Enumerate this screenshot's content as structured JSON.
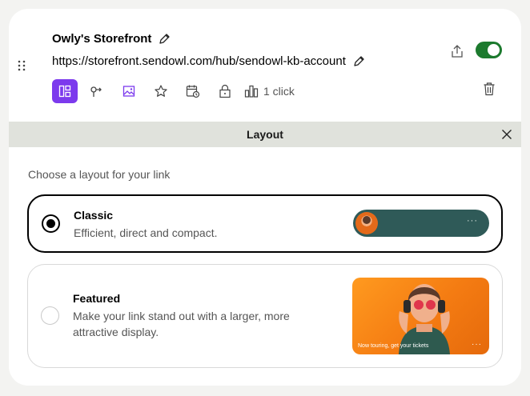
{
  "link": {
    "title": "Owly's Storefront",
    "url": "https://storefront.sendowl.com/hub/sendowl-kb-account",
    "enabled": true,
    "clicks_label": "1 click"
  },
  "toolbar": {
    "tools": [
      "layout-icon",
      "redirect-icon",
      "image-icon",
      "star-icon",
      "schedule-icon",
      "lock-icon",
      "analytics-icon"
    ],
    "active": "layout-icon"
  },
  "layout_panel": {
    "title": "Layout",
    "subtitle": "Choose a layout for your link",
    "options": [
      {
        "name": "Classic",
        "description": "Efficient, direct and compact.",
        "selected": true
      },
      {
        "name": "Featured",
        "description": "Make your link stand out with a larger, more attractive display.",
        "selected": false,
        "preview_caption": "Now touring, get your tickets"
      }
    ],
    "preview_menu": "···"
  },
  "colors": {
    "accent": "#7c3aed",
    "toggle_on": "#1c7a2e",
    "classic_preview_bg": "#2f5a58",
    "featured_preview_bg": "#f47b12",
    "header_bar": "#e0e2dc"
  }
}
